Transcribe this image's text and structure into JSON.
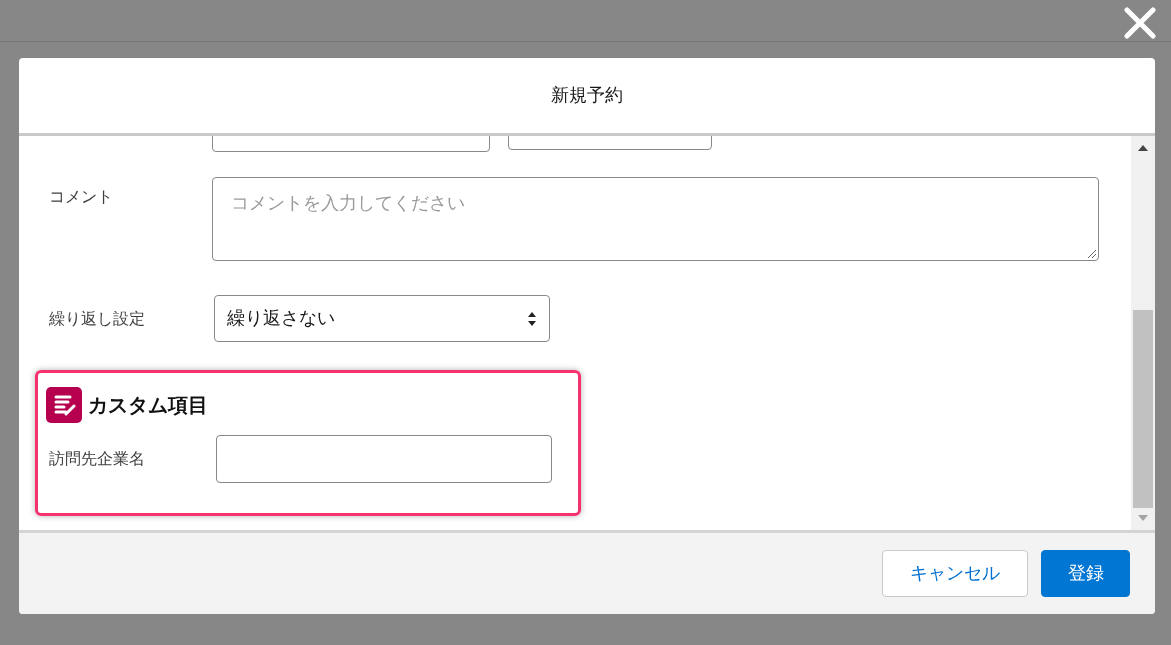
{
  "dialog": {
    "title": "新規予約"
  },
  "comment": {
    "label": "コメント",
    "placeholder": "コメントを入力してください"
  },
  "repeat": {
    "label": "繰り返し設定",
    "value": "繰り返さない"
  },
  "custom_section": {
    "title": "カスタム項目",
    "highlighted": true,
    "field": {
      "label": "訪問先企業名"
    }
  },
  "buttons": [
    {
      "label": "キャンセル",
      "kind": "neutral"
    },
    {
      "label": "登録",
      "kind": "brand"
    }
  ]
}
